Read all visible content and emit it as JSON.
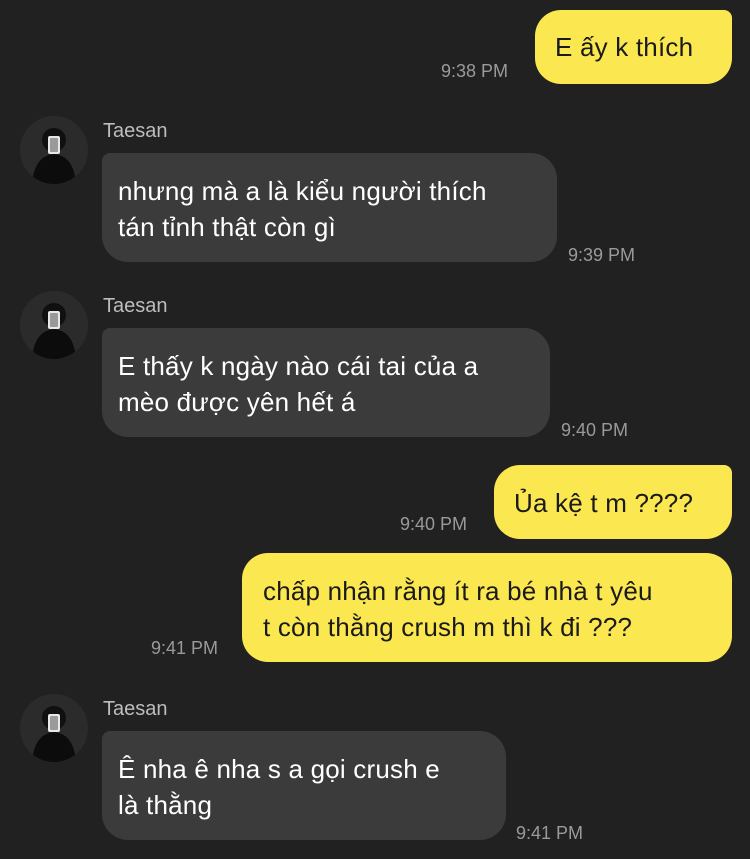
{
  "colors": {
    "background": "#212121",
    "outgoing_bubble": "#fbe74f",
    "incoming_bubble": "#3b3b3b",
    "timestamp": "#9a9a9a",
    "sender_name": "#bdbdbd"
  },
  "messages": [
    {
      "direction": "outgoing",
      "lines": [
        "E ấy k thích"
      ],
      "time": "9:38 PM"
    },
    {
      "direction": "incoming",
      "sender": "Taesan",
      "avatar_icon": "profile-photo-icon",
      "lines": [
        "nhưng mà a là kiểu người thích",
        "tán tỉnh thật còn gì"
      ],
      "time": "9:39 PM"
    },
    {
      "direction": "incoming",
      "sender": "Taesan",
      "avatar_icon": "profile-photo-icon",
      "lines": [
        "E thấy k ngày nào cái tai của a",
        "mèo được yên hết á"
      ],
      "time": "9:40 PM"
    },
    {
      "direction": "outgoing",
      "lines": [
        "Ủa kệ t m ????"
      ],
      "time": "9:40 PM"
    },
    {
      "direction": "outgoing",
      "lines": [
        "chấp nhận rằng ít ra bé nhà t yêu",
        "t còn thằng crush m thì k đi ???"
      ],
      "time": "9:41 PM"
    },
    {
      "direction": "incoming",
      "sender": "Taesan",
      "avatar_icon": "profile-photo-icon",
      "lines": [
        "Ê nha ê nha s a gọi crush e",
        "là thằng"
      ],
      "time": "9:41 PM"
    }
  ]
}
